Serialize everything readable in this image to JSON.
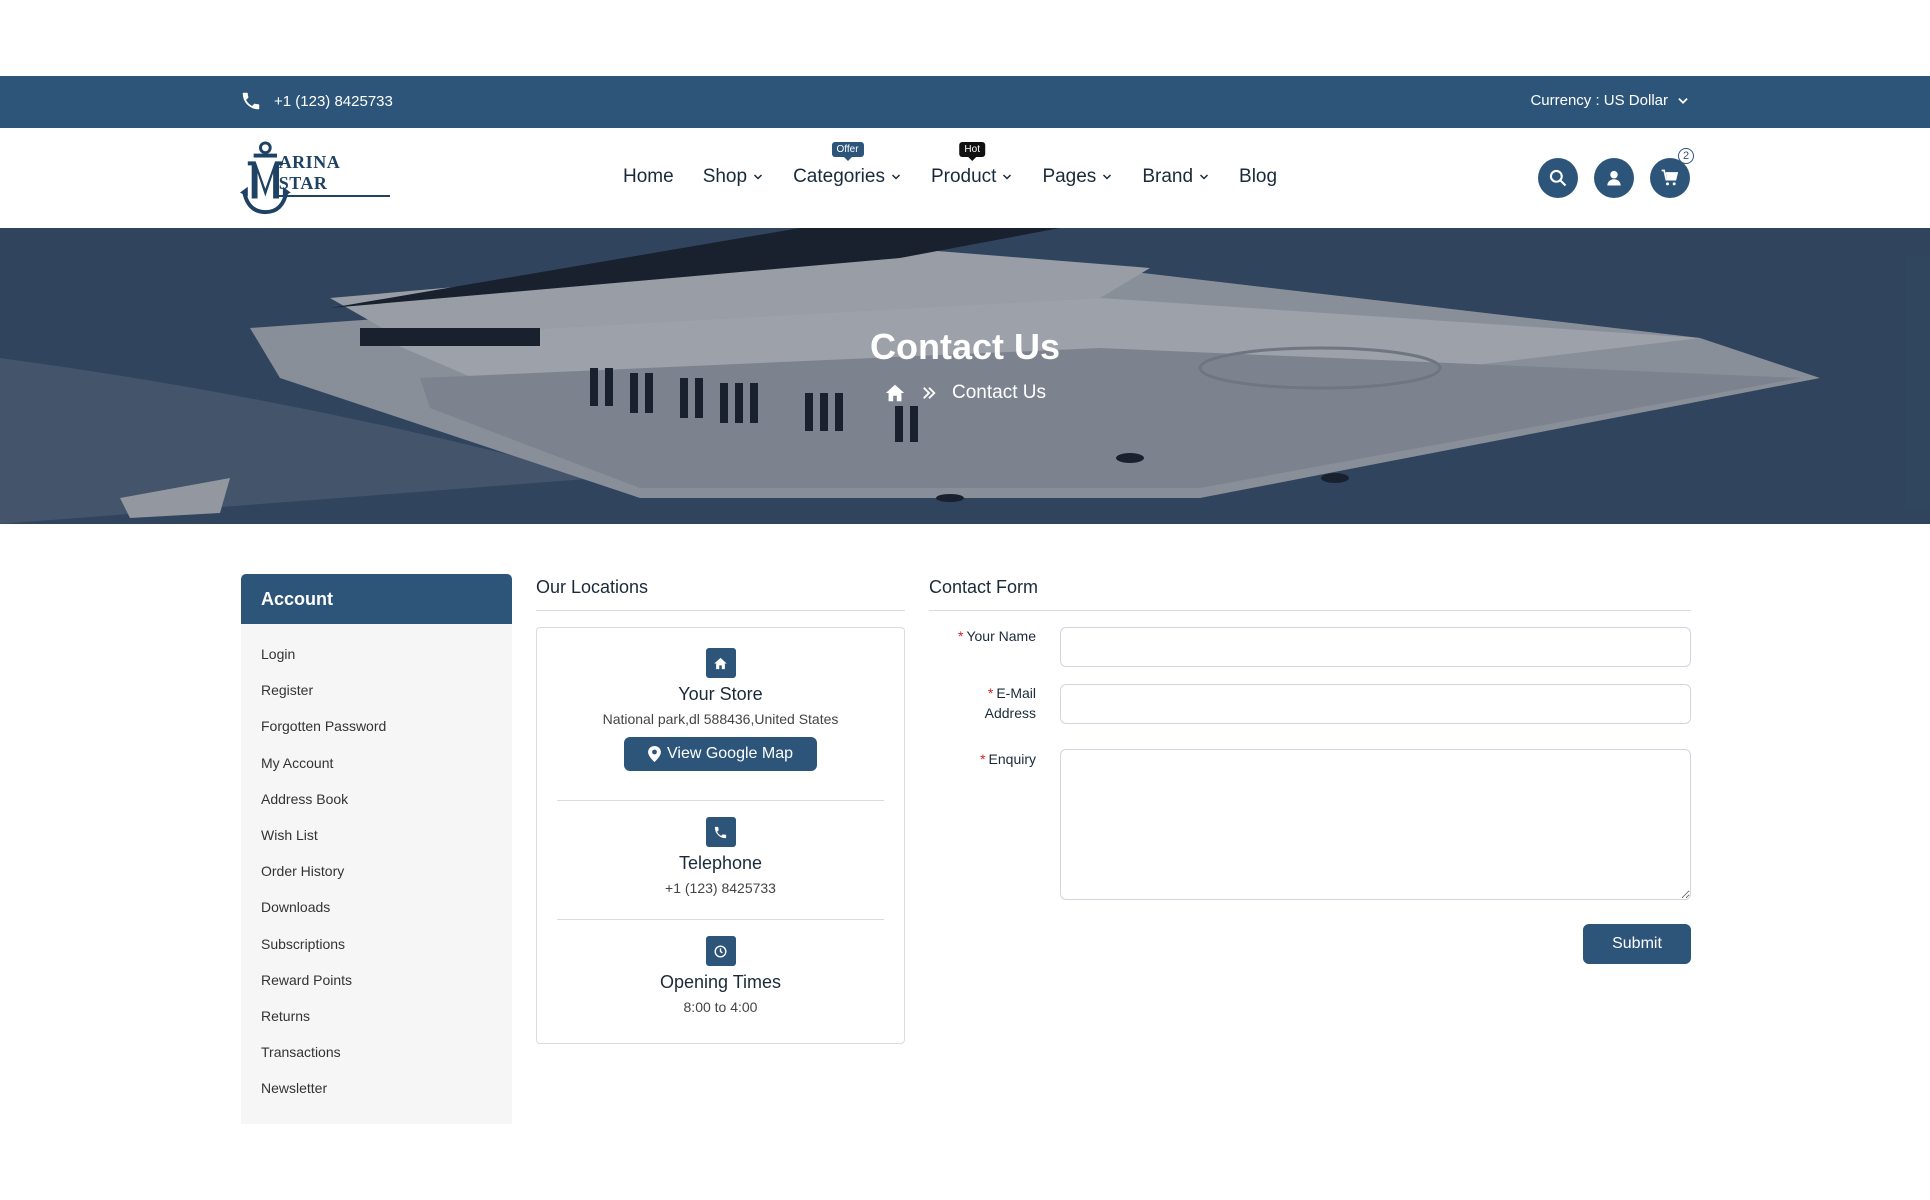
{
  "topbar": {
    "phone": "+1 (123) 8425733",
    "currency": "Currency : US Dollar"
  },
  "header": {
    "logo_text": "ARINA STAR",
    "nav": [
      {
        "label": "Home",
        "dropdown": false,
        "badge": ""
      },
      {
        "label": "Shop",
        "dropdown": true,
        "badge": ""
      },
      {
        "label": "Categories",
        "dropdown": true,
        "badge": "Offer"
      },
      {
        "label": "Product",
        "dropdown": true,
        "badge": "Hot"
      },
      {
        "label": "Pages",
        "dropdown": true,
        "badge": ""
      },
      {
        "label": "Brand",
        "dropdown": true,
        "badge": ""
      },
      {
        "label": "Blog",
        "dropdown": false,
        "badge": ""
      }
    ],
    "icons": [
      "search-icon",
      "user-icon",
      "cart-icon"
    ],
    "cart_count": "2"
  },
  "banner": {
    "title": "Contact Us",
    "breadcrumb_current": "Contact Us"
  },
  "account": {
    "title": "Account",
    "items": [
      "Login",
      "Register",
      "Forgotten Password",
      "My Account",
      "Address Book",
      "Wish List",
      "Order History",
      "Downloads",
      "Subscriptions",
      "Reward Points",
      "Returns",
      "Transactions",
      "Newsletter"
    ]
  },
  "locations": {
    "title": "Our Locations",
    "store": {
      "name": "Your Store",
      "address": "National park,dl 588436,United States",
      "button": "View Google Map"
    },
    "telephone": {
      "name": "Telephone",
      "value": "+1 (123) 8425733"
    },
    "opening": {
      "name": "Opening Times",
      "value": "8:00 to 4:00"
    }
  },
  "contact_form": {
    "title": "Contact Form",
    "name_label": "Your Name",
    "email_label_line1": "E-Mail",
    "email_label_line2": "Address",
    "enquiry_label": "Enquiry",
    "submit": "Submit",
    "name_value": "",
    "email_value": "",
    "enquiry_value": ""
  },
  "colors": {
    "primary": "#2d557a",
    "required": "#d42020"
  }
}
